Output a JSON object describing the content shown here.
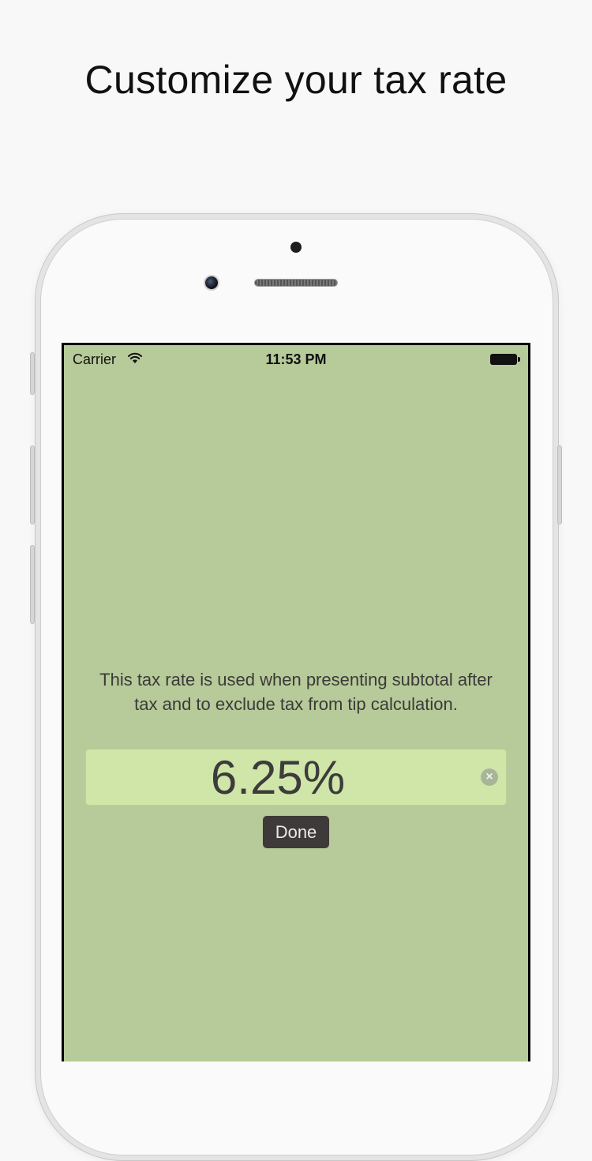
{
  "headline": "Customize your tax rate",
  "status_bar": {
    "carrier": "Carrier",
    "time": "11:53 PM",
    "wifi_icon": "wifi-icon",
    "battery_icon": "battery-icon"
  },
  "settings": {
    "description": "This tax rate is used when presenting subtotal after tax and to exclude tax from tip calculation.",
    "tax_rate_value": "6.25%",
    "clear_icon": "clear-icon",
    "done_label": "Done"
  },
  "colors": {
    "screen_background": "#b7ca99",
    "field_background": "#cfe6a8",
    "done_button": "#3e3a3a"
  }
}
